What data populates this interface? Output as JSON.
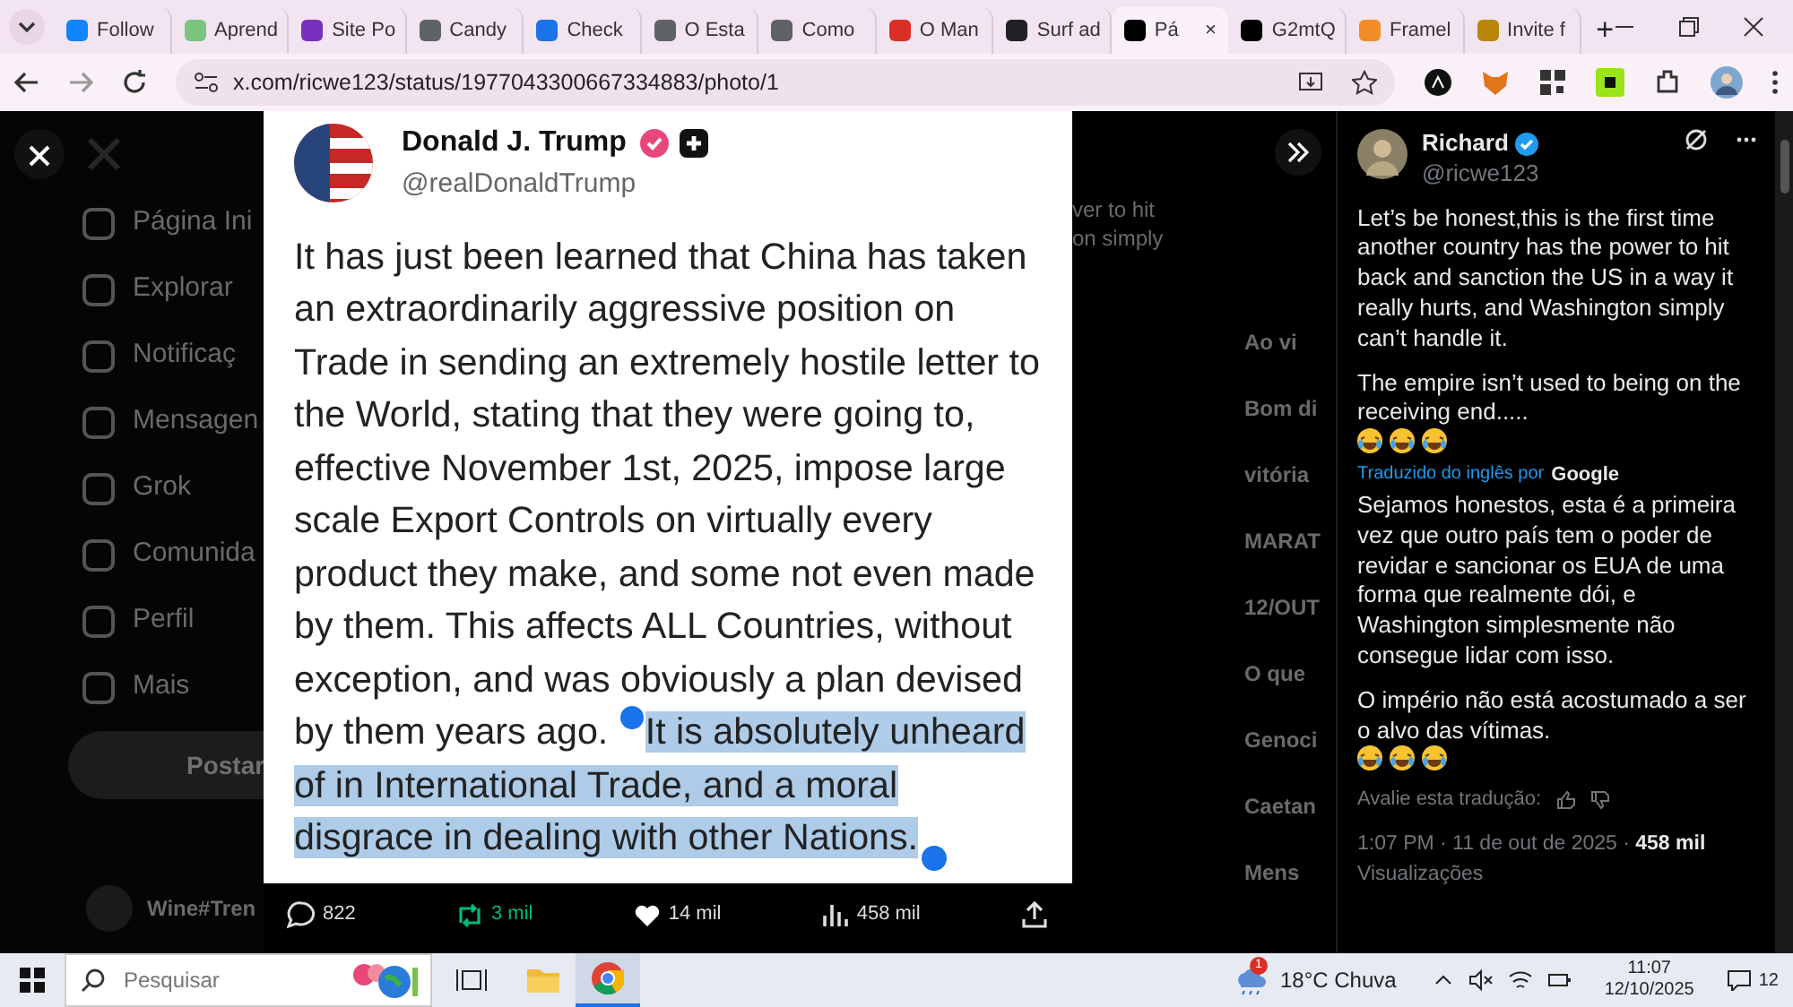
{
  "browser": {
    "tabs": [
      {
        "label": "Follow",
        "color": "#1185fe",
        "selected": false
      },
      {
        "label": "Aprend",
        "color": "#7bc47f",
        "selected": false
      },
      {
        "label": "Site Po",
        "color": "#7b2fbf",
        "selected": false
      },
      {
        "label": "Candy",
        "color": "#5f6368",
        "selected": false
      },
      {
        "label": "Check",
        "color": "#1a73e8",
        "selected": false
      },
      {
        "label": "O Esta",
        "color": "#5f6368",
        "selected": false
      },
      {
        "label": "Como",
        "color": "#5f6368",
        "selected": false
      },
      {
        "label": "O Man",
        "color": "#d93025",
        "selected": false
      },
      {
        "label": "Surf ad",
        "color": "#202124",
        "selected": false
      },
      {
        "label": "Pá",
        "color": "#000000",
        "selected": true
      },
      {
        "label": "G2mtQ",
        "color": "#000000",
        "selected": false
      },
      {
        "label": "Framel",
        "color": "#f28c28",
        "selected": false
      },
      {
        "label": "Invite f",
        "color": "#b8860b",
        "selected": false
      }
    ],
    "new_tab": "+",
    "close_tab": "×",
    "url": "x.com/ricwe123/status/1977043300667334883/photo/1"
  },
  "sidebar": {
    "items": [
      "Página Ini",
      "Explorar",
      "Notificaç",
      "Mensagen",
      "Grok",
      "Comunida",
      "Perfil",
      "Mais"
    ],
    "post_button": "Postar",
    "account": "Wine#Tren"
  },
  "post_image": {
    "author": "Donald J. Trump",
    "handle": "@realDonaldTrump",
    "text": "It has just been learned that China has taken an extraordinarily aggressive position on Trade in sending an extremely hostile letter to the World, stating that they were going to, effective November 1st, 2025, impose large scale Export Controls on virtually every product they make, and some not even made by them. This affects ALL Countries, without exception, and was obviously a plan devised by them years ago. ",
    "selected_text": "It is absolutely unheard of in International Trade, and a moral disgrace in dealing with other Nations."
  },
  "actions": [
    {
      "kind": "reply",
      "count": "822"
    },
    {
      "kind": "repost",
      "count": "3 mil"
    },
    {
      "kind": "like",
      "count": "14 mil"
    },
    {
      "kind": "views",
      "count": "458 mil"
    },
    {
      "kind": "share"
    }
  ],
  "background_text": [
    "ver to hit",
    "on simply"
  ],
  "background_trends": [
    "Ao vi",
    "Bom di",
    "vitória",
    "MARAT",
    "12/OUT",
    "O que",
    "Genoci",
    "Caetan",
    "Mens"
  ],
  "reply_panel": {
    "name": "Richard",
    "handle": "@ricwe123",
    "paragraphs": [
      "Let’s be honest,this is the first time another country has the power to hit back and sanction the US in a way it really hurts, and Washington simply can’t handle it.",
      "The empire isn’t used to being on the receiving end....."
    ],
    "translation_label": "Traduzido do inglês por",
    "translation_provider": "Google",
    "translated": [
      "Sejamos honestos, esta é a primeira vez que outro país tem o poder de revidar e sancionar os EUA de uma forma que realmente dói, e Washington simplesmente não consegue lidar com isso.",
      "O império não está acostumado a ser o alvo das vítimas."
    ],
    "rate_label": "Avalie esta tradução:",
    "timestamp": "1:07 PM · 11 de out de 2025 · ",
    "views": "458 mil",
    "views_label": "Visualizações"
  },
  "taskbar": {
    "search_placeholder": "Pesquisar",
    "weather": "18°C Chuva",
    "weather_badge": "1",
    "time": "11:07",
    "date": "12/10/2025",
    "notifications": "12"
  }
}
